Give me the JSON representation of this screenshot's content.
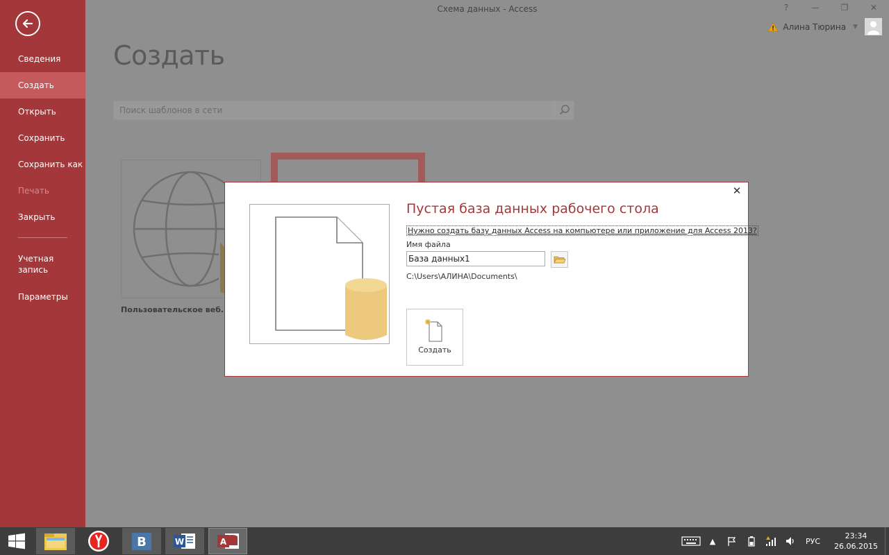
{
  "window": {
    "title": "Схема данных - Access",
    "help": "?"
  },
  "user": {
    "name": "Алина Тюрина"
  },
  "sidebar": {
    "items": [
      {
        "label": "Сведения"
      },
      {
        "label": "Создать"
      },
      {
        "label": "Открыть"
      },
      {
        "label": "Сохранить"
      },
      {
        "label": "Сохранить как"
      },
      {
        "label": "Печать"
      },
      {
        "label": "Закрыть"
      },
      {
        "label": "Учетная запись"
      },
      {
        "label": "Параметры"
      }
    ]
  },
  "main": {
    "heading": "Создать",
    "search_placeholder": "Поиск шаблонов в сети",
    "templates": [
      {
        "label": "Пользовательское веб..."
      }
    ]
  },
  "dialog": {
    "title": "Пустая база данных рабочего стола",
    "link": "Нужно создать базу данных Access на компьютере или приложение для Access 2013?",
    "filename_label": "Имя файла",
    "filename_value": "База данных1",
    "path": "C:\\Users\\АЛИНА\\Documents\\",
    "create_label": "Создать",
    "close_glyph": "✕"
  },
  "taskbar": {
    "apps": [
      "File Explorer",
      "Yandex Browser",
      "VK",
      "Word",
      "Access"
    ],
    "language": "РУС",
    "time": "23:34",
    "date": "26.06.2015"
  },
  "colors": {
    "accent": "#a4373a",
    "sidebar_active": "#c55a5d",
    "db_yellow": "#edc97e"
  }
}
